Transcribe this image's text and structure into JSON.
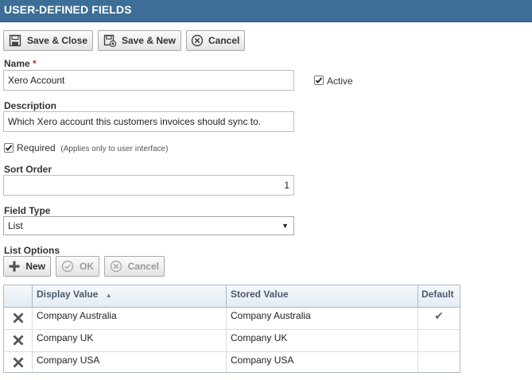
{
  "header": {
    "title": "USER-DEFINED FIELDS"
  },
  "toolbar": {
    "save_close_label": "Save & Close",
    "save_new_label": "Save & New",
    "cancel_label": "Cancel"
  },
  "form": {
    "name_label": "Name",
    "required_marker": "*",
    "name_value": "Xero Account",
    "active_label": "Active",
    "active_checked": true,
    "description_label": "Description",
    "description_value": "Which Xero account this customers invoices should sync to.",
    "required_label": "Required",
    "required_note": "(Applies only to user interface)",
    "required_checked": true,
    "sort_order_label": "Sort Order",
    "sort_order_value": "1",
    "field_type_label": "Field Type",
    "field_type_value": "List",
    "list_options_label": "List Options"
  },
  "list_toolbar": {
    "new_label": "New",
    "ok_label": "OK",
    "cancel_label": "Cancel"
  },
  "table": {
    "columns": {
      "display_value": "Display Value",
      "sort_indicator": "▲",
      "stored_value": "Stored Value",
      "default": "Default"
    },
    "rows": [
      {
        "display": "Company Australia",
        "stored": "Company Australia",
        "default_mark": "✔"
      },
      {
        "display": "Company UK",
        "stored": "Company UK",
        "default_mark": ""
      },
      {
        "display": "Company USA",
        "stored": "Company USA",
        "default_mark": ""
      }
    ]
  },
  "colors": {
    "header_bg": "#3c6e97",
    "grid_header_text": "#4a5a6a"
  },
  "icons": {
    "save_close": "floppy-disk-icon",
    "save_new": "floppy-disk-plus-icon",
    "cancel": "circle-x-icon",
    "new": "plus-icon",
    "ok": "circle-check-icon",
    "delete": "x-icon",
    "checkmark": "checkmark-icon"
  }
}
